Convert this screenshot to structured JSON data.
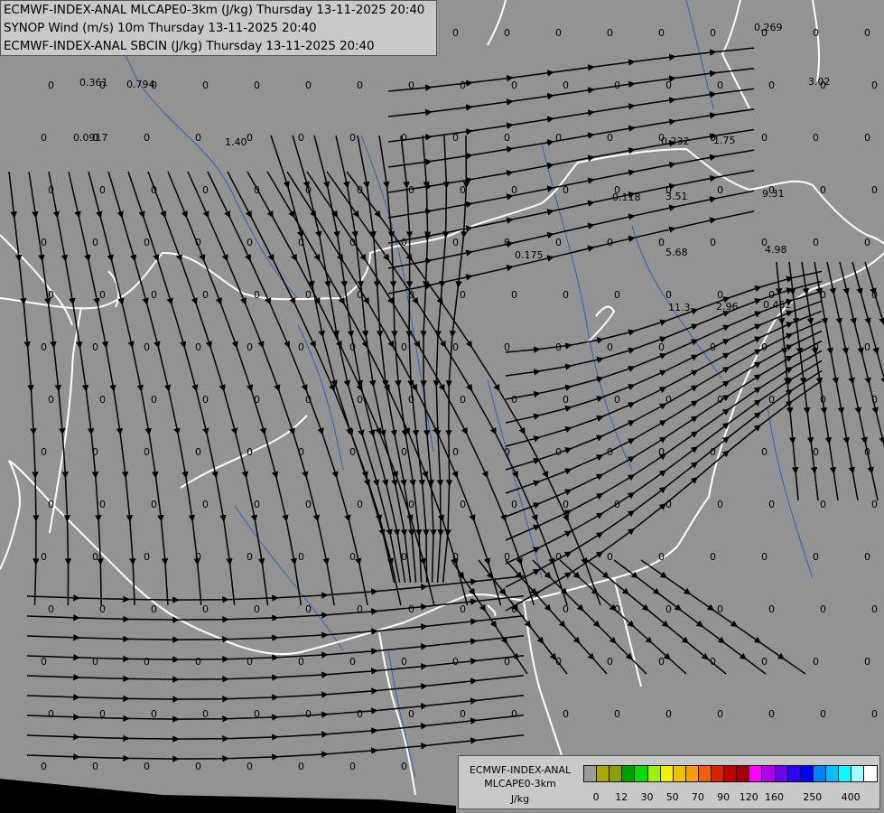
{
  "header": {
    "line1": "ECMWF-INDEX-ANAL MLCAPE0-3km (J/kg) Thursday 13-11-2025 20:40",
    "line2": "SYNOP Wind (m/s) 10m Thursday 13-11-2025 20:40",
    "line3": "ECMWF-INDEX-ANAL SBCIN (J/kg) Thursday 13-11-2025 20:40"
  },
  "legend": {
    "source": "ECMWF-INDEX-ANAL",
    "parameter": "MLCAPE0-3km",
    "unit": "J/kg",
    "colors": [
      "#9a9a9a",
      "#a8a800",
      "#8ca000",
      "#00a000",
      "#00e000",
      "#a0f000",
      "#f0f000",
      "#f0c000",
      "#f0a000",
      "#f06000",
      "#e02000",
      "#c00000",
      "#a00000",
      "#ff00ff",
      "#b000f0",
      "#7000f0",
      "#3000ff",
      "#0000ff",
      "#0080ff",
      "#00c0ff",
      "#00ffff",
      "#a0ffff",
      "#ffffff"
    ],
    "ticks": [
      "0",
      "12",
      "30",
      "50",
      "70",
      "90",
      "120",
      "160",
      "250",
      "400"
    ]
  },
  "map_labels": [
    "0.361",
    "0.794",
    "0.0917",
    "1.40",
    "0.269",
    "3.02",
    "0.232",
    "1.75",
    "0.118",
    "3.51",
    "9.31",
    "4.98",
    "0.175",
    "5.68",
    "11.3",
    "2.96",
    "0.452"
  ],
  "theme": {
    "background": "#939393",
    "streamline": "#000000",
    "border": "#ffffff",
    "river": "#2b63c8"
  }
}
